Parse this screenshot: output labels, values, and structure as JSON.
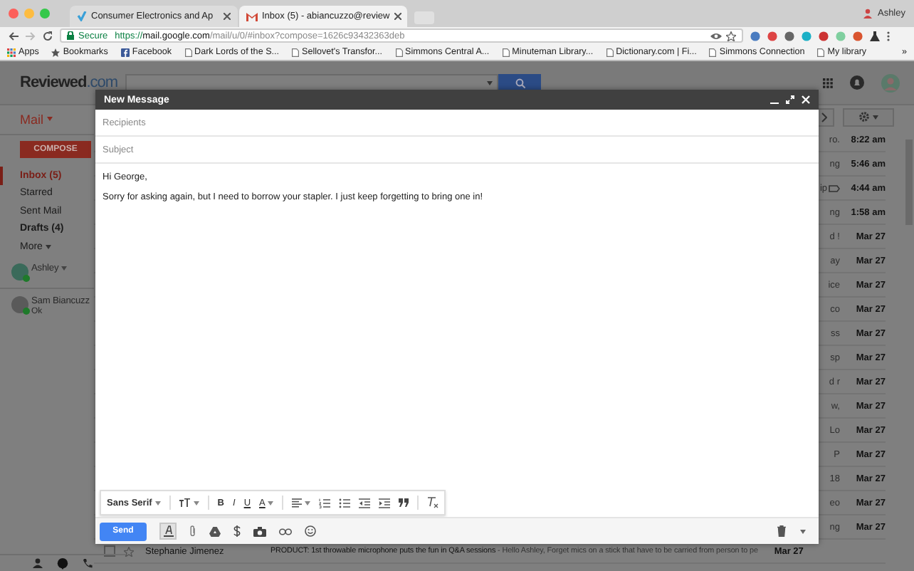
{
  "browser": {
    "tabs": [
      {
        "title": "Consumer Electronics and Ap",
        "selected": false
      },
      {
        "title": "Inbox (5) - abiancuzzo@review",
        "selected": true
      }
    ],
    "profile": "Ashley",
    "secure_label": "Secure",
    "url_scheme": "https://",
    "url_host": "mail.google.com",
    "url_path": "/mail/u/0/#inbox?compose=1626c93432363deb",
    "bookmarks": [
      {
        "label": "Apps",
        "kind": "apps"
      },
      {
        "label": "Bookmarks",
        "kind": "star"
      },
      {
        "label": "Facebook",
        "kind": "facebook"
      },
      {
        "label": "Dark Lords of the S...",
        "kind": "page"
      },
      {
        "label": "Sellovet's Transfor...",
        "kind": "page"
      },
      {
        "label": "Simmons Central A...",
        "kind": "page"
      },
      {
        "label": "Minuteman Library...",
        "kind": "page"
      },
      {
        "label": "Dictionary.com | Fi...",
        "kind": "page"
      },
      {
        "label": "Simmons Connection",
        "kind": "page"
      },
      {
        "label": "My library",
        "kind": "page"
      }
    ],
    "more_bookmarks": "»"
  },
  "gmail": {
    "logo": "Reviewed",
    "logo_suffix": ".com",
    "mail_label": "Mail",
    "compose_button": "COMPOSE",
    "nav": [
      {
        "label": "Inbox (5)",
        "selected": true,
        "unread": true
      },
      {
        "label": "Starred",
        "selected": false,
        "unread": false
      },
      {
        "label": "Sent Mail",
        "selected": false,
        "unread": false
      },
      {
        "label": "Drafts (4)",
        "selected": false,
        "unread": true
      }
    ],
    "more": "More",
    "contacts": [
      {
        "name": "Ashley",
        "kind": "self"
      },
      {
        "name": "Sam Biancuzz",
        "kind": "contact",
        "status": "Ok"
      }
    ],
    "rows": [
      {
        "kind": "covered",
        "fragment": "ro.",
        "time": "8:22 am",
        "labeled": false
      },
      {
        "kind": "covered",
        "fragment": "ng",
        "time": "5:46 am",
        "labeled": false
      },
      {
        "kind": "covered",
        "fragment": "ip",
        "time": "4:44 am",
        "labeled": true
      },
      {
        "kind": "covered",
        "fragment": "ng",
        "time": "1:58 am",
        "labeled": false
      },
      {
        "kind": "covered",
        "fragment": "d !",
        "time": "Mar 27",
        "labeled": false
      },
      {
        "kind": "covered",
        "fragment": "ay",
        "time": "Mar 27",
        "labeled": false
      },
      {
        "kind": "covered",
        "fragment": "ice",
        "time": "Mar 27",
        "labeled": false
      },
      {
        "kind": "covered",
        "fragment": "co",
        "time": "Mar 27",
        "labeled": false
      },
      {
        "kind": "covered",
        "fragment": "ss",
        "time": "Mar 27",
        "labeled": false
      },
      {
        "kind": "covered",
        "fragment": "sp",
        "time": "Mar 27",
        "labeled": false
      },
      {
        "kind": "covered",
        "fragment": "d r",
        "time": "Mar 27",
        "labeled": false
      },
      {
        "kind": "covered",
        "fragment": "w,",
        "time": "Mar 27",
        "labeled": false
      },
      {
        "kind": "covered",
        "fragment": "Lo",
        "time": "Mar 27",
        "labeled": false
      },
      {
        "kind": "covered",
        "fragment": "P",
        "time": "Mar 27",
        "labeled": false
      },
      {
        "kind": "covered",
        "fragment": "18",
        "time": "Mar 27",
        "labeled": false
      },
      {
        "kind": "covered",
        "fragment": "eo",
        "time": "Mar 27",
        "labeled": false
      },
      {
        "kind": "covered",
        "fragment": "ng",
        "time": "Mar 27",
        "labeled": false
      },
      {
        "kind": "full",
        "sender": "Stephanie Jimenez",
        "subject": "PRODUCT: 1st throwable microphone puts the fun in Q&A sessions",
        "snippet": " - Hello Ashley, Forget mics on a stick that have to be carried from person to pe",
        "time": "Mar 27",
        "labeled": false
      }
    ]
  },
  "compose": {
    "title": "New Message",
    "recipients_placeholder": "Recipients",
    "subject_placeholder": "Subject",
    "body": [
      "Hi George,",
      "Sorry for asking again, but I need to borrow your stapler. I just keep forgetting to bring one in!"
    ],
    "font": "Sans Serif",
    "format_letters": [
      "B",
      "I",
      "U",
      "A"
    ],
    "send": "Send",
    "formatting_on": true
  }
}
